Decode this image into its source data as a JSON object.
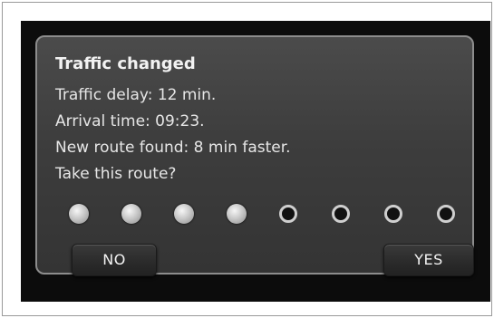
{
  "dialog": {
    "title": "Traffic changed",
    "lines": [
      "Traffic delay: 12 min.",
      "Arrival time: 09:23.",
      "New route found: 8 min faster.",
      "Take this route?"
    ],
    "countdown": {
      "total": 8,
      "filled": 4
    },
    "buttons": {
      "no": "NO",
      "yes": "YES"
    }
  }
}
